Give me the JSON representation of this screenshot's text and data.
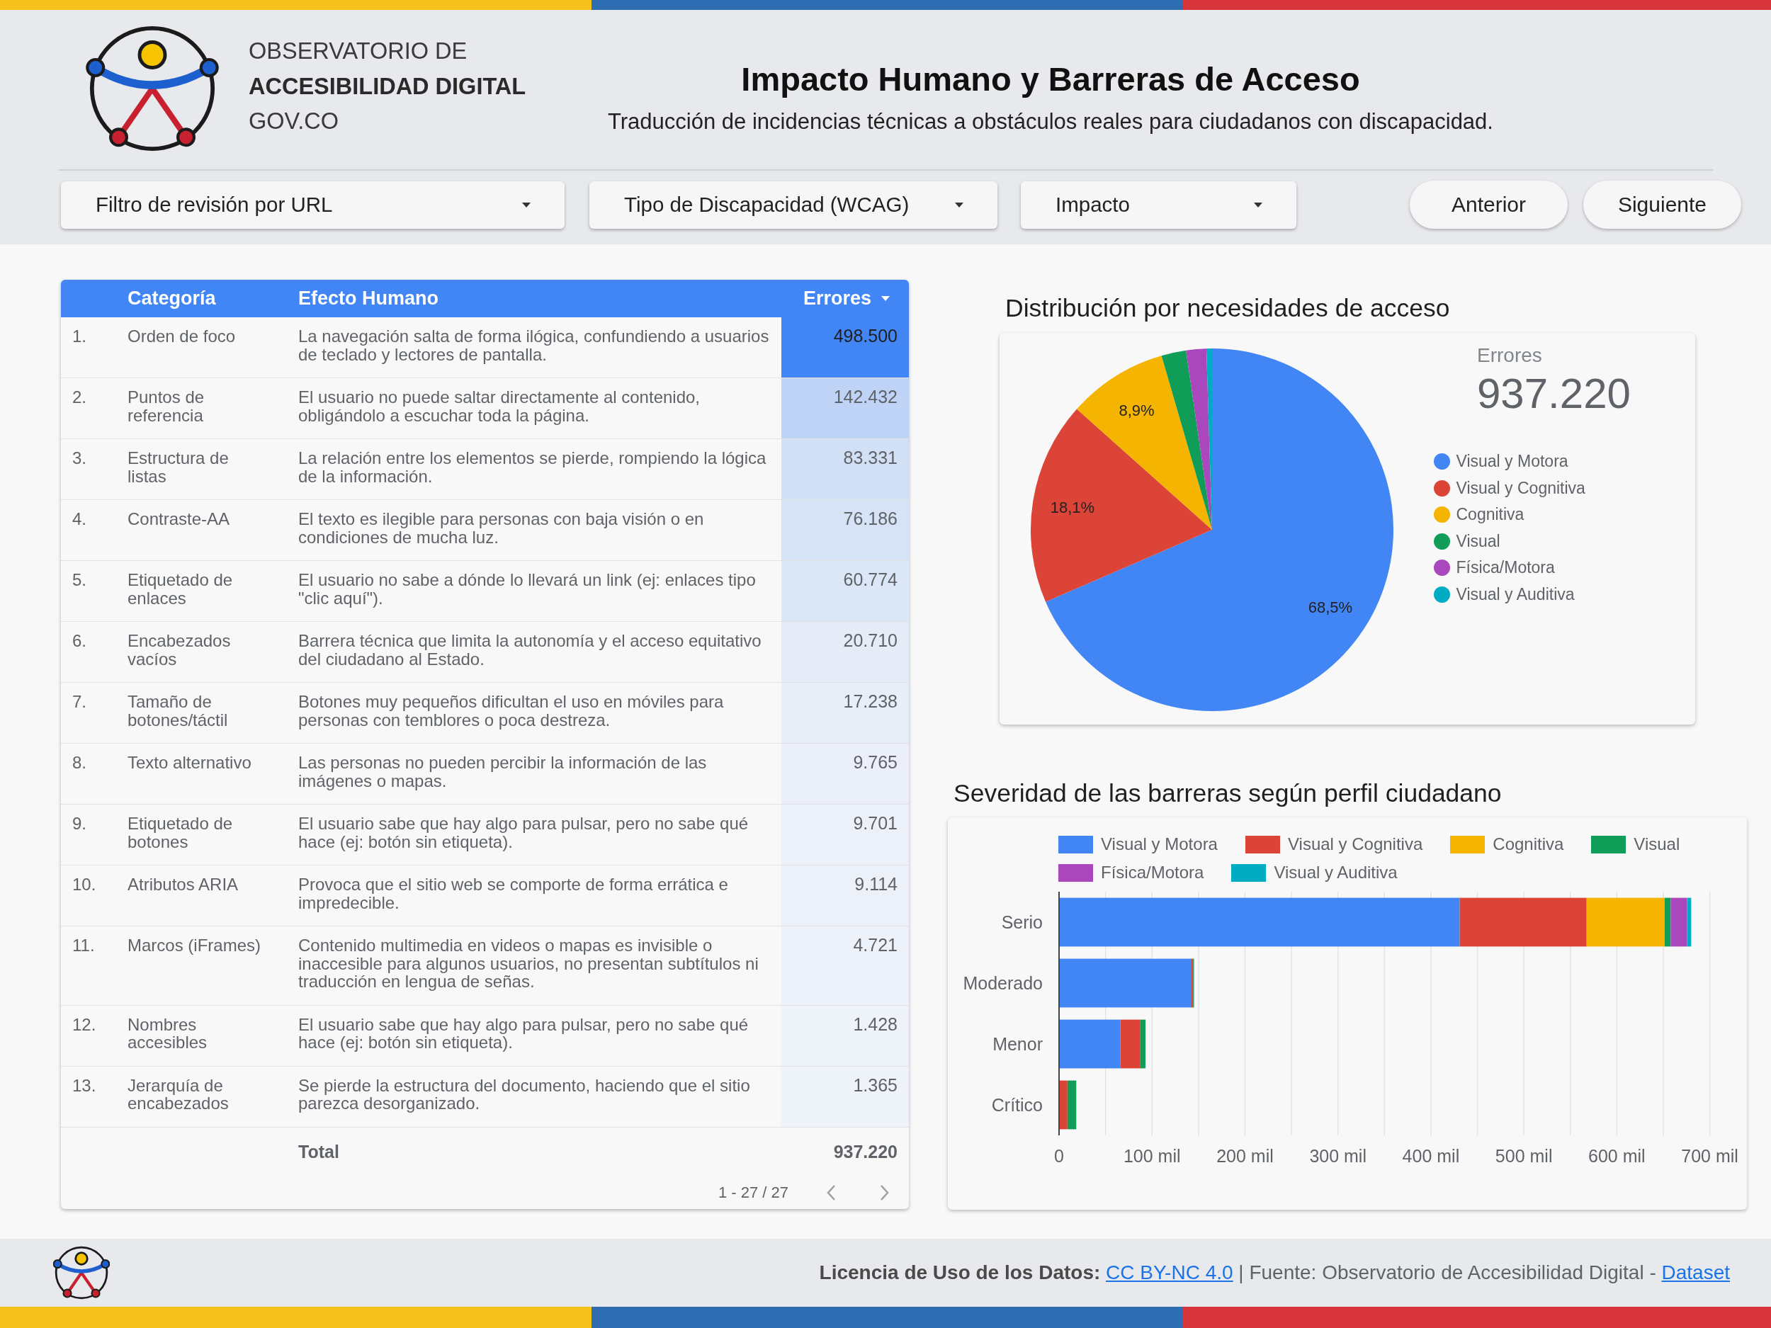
{
  "header": {
    "logo_text": [
      {
        "text": "OBSERVATORIO DE",
        "bold": false
      },
      {
        "text": "ACCESIBILIDAD DIGITAL",
        "bold": true
      },
      {
        "text": "GOV.CO",
        "bold": false
      }
    ],
    "title": "Impacto Humano y Barreras de Acceso",
    "subtitle": "Traducción de incidencias técnicas a obstáculos reales para ciudadanos con discapacidad."
  },
  "filters": [
    {
      "label": "Filtro de revisión por URL"
    },
    {
      "label": "Tipo de Discapacidad (WCAG)"
    },
    {
      "label": "Impacto"
    }
  ],
  "nav_buttons": [
    "Anterior",
    "Siguiente"
  ],
  "table": {
    "columns": [
      {
        "label": "Categoría",
        "sorted": false
      },
      {
        "label": "Efecto Humano",
        "sorted": false
      },
      {
        "label": "Errores",
        "sorted": true
      }
    ],
    "rows": [
      {
        "index": "1.",
        "category": "Orden de foco",
        "effect": "La navegación salta de forma ilógica, confundiendo a usuarios de teclado y lectores de pantalla.",
        "errors": "498.500",
        "color": "#4285f4"
      },
      {
        "index": "2.",
        "category": "Puntos de referencia",
        "effect": "El usuario no puede saltar directamente al contenido, obligándolo a escuchar toda la página.",
        "errors": "142.432",
        "color": "#bfd3f6"
      },
      {
        "index": "3.",
        "category": "Estructura de listas",
        "effect": "La relación entre los elementos se pierde, rompiendo la lógica de la información.",
        "errors": "83.331",
        "color": "#d2e0f6"
      },
      {
        "index": "4.",
        "category": "Contraste-AA",
        "effect": "El texto es ilegible para personas con baja visión o en condiciones de mucha luz.",
        "errors": "76.186",
        "color": "#d6e3f6"
      },
      {
        "index": "5.",
        "category": "Etiquetado de enlaces",
        "effect": "El usuario no sabe a dónde lo llevará un link (ej: enlaces tipo \"clic aquí\").",
        "errors": "60.774",
        "color": "#dbe6f7"
      },
      {
        "index": "6.",
        "category": "Encabezados vacíos",
        "effect": "Barrera técnica que limita la autonomía y el acceso equitativo del ciudadano al Estado.",
        "errors": "20.710",
        "color": "#e5ecf8"
      },
      {
        "index": "7.",
        "category": "Tamaño de botones/táctil",
        "effect": "Botones muy pequeños dificultan el uso en móviles para personas con temblores o poca destreza.",
        "errors": "17.238",
        "color": "#e8eef8"
      },
      {
        "index": "8.",
        "category": "Texto alternativo",
        "effect": "Las personas no pueden percibir la información de las imágenes o mapas.",
        "errors": "9.765",
        "color": "#eaeff9"
      },
      {
        "index": "9.",
        "category": "Etiquetado de botones",
        "effect": "El usuario sabe que hay algo para pulsar, pero no sabe qué hace (ej: botón sin etiqueta).",
        "errors": "9.701",
        "color": "#ebf0f9"
      },
      {
        "index": "10.",
        "category": "Atributos ARIA",
        "effect": "Provoca que el sitio web se comporte de forma errática e impredecible.",
        "errors": "9.114",
        "color": "#ecf1f9"
      },
      {
        "index": "11.",
        "category": "Marcos (iFrames)",
        "effect": "Contenido multimedia en videos o mapas es invisible o inaccesible para algunos usuarios, no presentan subtítulos ni traducción en lengua de señas.",
        "errors": "4.721",
        "color": "#edf1f9"
      },
      {
        "index": "12.",
        "category": "Nombres accesibles",
        "effect": "El usuario sabe que hay algo para pulsar, pero no sabe qué hace (ej: botón sin etiqueta).",
        "errors": "1.428",
        "color": "#eef2f9"
      },
      {
        "index": "13.",
        "category": "Jerarquía de encabezados",
        "effect": "Se pierde la estructura del documento, haciendo que el sitio parezca desorganizado.",
        "errors": "1.365",
        "color": "#eef2f9"
      }
    ],
    "total": {
      "label": "Total",
      "value": "937.220"
    },
    "pagination": "1 - 27 / 27"
  },
  "distribution": {
    "chart_data": {
      "type": "pie",
      "title": "Distribución por necesidades de acceso",
      "categories": [
        "Visual y Motora",
        "Visual y Cognitiva",
        "Cognitiva",
        "Visual",
        "Física/Motora",
        "Visual y Auditiva"
      ],
      "values": [
        68.5,
        18.1,
        8.9,
        2.2,
        1.8,
        0.5
      ],
      "colors": [
        "#4285f4",
        "#db4437",
        "#f4b400",
        "#0f9d58",
        "#ab47bc",
        "#00acc1"
      ],
      "value_labels": [
        "68,5%",
        "18,1%",
        "8,9%",
        null,
        null,
        null
      ],
      "legend": "right"
    },
    "scorecard": {
      "label": "Errores",
      "value": "937.220"
    }
  },
  "severity": {
    "chart_data": {
      "type": "bar",
      "orientation": "horizontal",
      "stacked": true,
      "title": "Severidad de las barreras según perfil ciudadano",
      "categories": [
        "Serio",
        "Moderado",
        "Menor",
        "Crítico"
      ],
      "series": [
        {
          "name": "Visual y Motora",
          "color": "#4285f4",
          "values": [
            431,
            142.5,
            66,
            0
          ]
        },
        {
          "name": "Visual y Cognitiva",
          "color": "#db4437",
          "values": [
            136.5,
            1.7,
            21,
            9
          ]
        },
        {
          "name": "Cognitiva",
          "color": "#f4b400",
          "values": [
            84,
            0,
            0,
            0
          ]
        },
        {
          "name": "Visual",
          "color": "#0f9d58",
          "values": [
            6.5,
            1,
            6,
            9.5
          ]
        },
        {
          "name": "Física/Motora",
          "color": "#ab47bc",
          "values": [
            17.5,
            0,
            0,
            0
          ]
        },
        {
          "name": "Visual y Auditiva",
          "color": "#00acc1",
          "values": [
            4.5,
            0,
            0,
            0
          ]
        }
      ],
      "xlim": [
        0,
        700
      ],
      "xticks": [
        0,
        {
          "value": 100,
          "label": "100 mil"
        },
        {
          "value": 200,
          "label": "200 mil"
        },
        {
          "value": 300,
          "label": "300 mil"
        },
        {
          "value": 400,
          "label": "400 mil"
        },
        {
          "value": 500,
          "label": "500 mil"
        },
        {
          "value": 600,
          "label": "600 mil"
        },
        {
          "value": 700,
          "label": "700 mil"
        }
      ],
      "grid": true,
      "legend": "top"
    }
  },
  "footer": {
    "license_label": "Licencia de Uso de los Datos:",
    "license_link": "CC BY-NC 4.0",
    "source_text": "| Fuente: Observatorio de Accesibilidad Digital -",
    "dataset_link": "Dataset"
  }
}
